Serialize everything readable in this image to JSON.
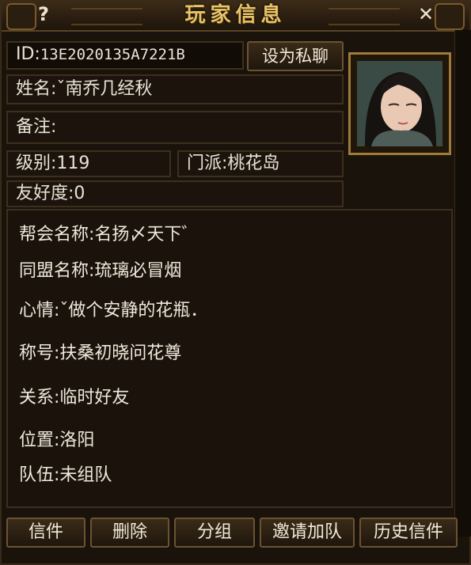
{
  "window": {
    "title": "玩家信息",
    "help_glyph": "?",
    "close_glyph": "✕"
  },
  "player": {
    "id_label": "ID:",
    "id_value": "13E2020135A7221B",
    "name_label": "姓名:",
    "name_value": "ˇ南乔几经秋",
    "note_label": "备注:",
    "note_value": "",
    "level_label": "级别:",
    "level_value": "119",
    "sect_label": "门派:",
    "sect_value": "桃花岛",
    "friendship_label": "友好度:",
    "friendship_value": "0"
  },
  "actions": {
    "private_chat": "设为私聊"
  },
  "details": [
    {
      "label": "帮会名称:",
      "value": "名扬〆天下゛"
    },
    {
      "label": "同盟名称:",
      "value": "琉璃必冒烟"
    },
    {
      "label": "心情:",
      "value": "ˇ做个安静的花瓶．"
    },
    {
      "label": "称号:",
      "value": "扶桑初晓问花尊"
    },
    {
      "label": "关系:",
      "value": "临时好友"
    },
    {
      "label": "位置:",
      "value": "洛阳"
    },
    {
      "label": "队伍:",
      "value": "未组队"
    }
  ],
  "bottom_buttons": {
    "mail": "信件",
    "delete": "删除",
    "group": "分组",
    "invite_team": "邀请加队",
    "mail_history": "历史信件"
  },
  "colors": {
    "accent_gold": "#e8c467",
    "frame": "#a07a3a",
    "bg": "#1a130c",
    "text": "#efe9dc"
  }
}
